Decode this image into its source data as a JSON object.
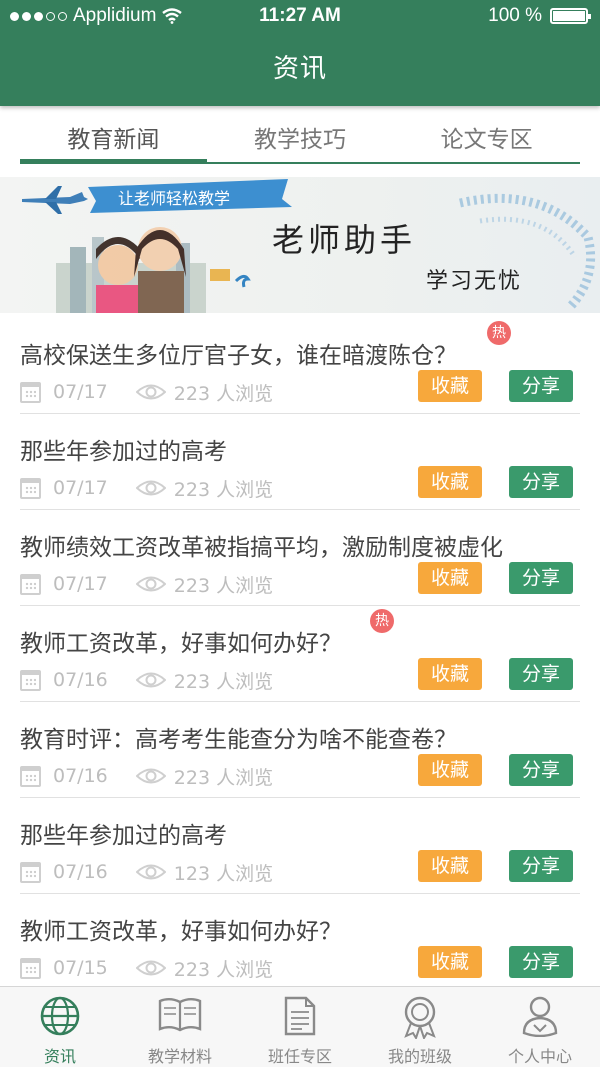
{
  "status": {
    "carrier": "Applidium",
    "time": "11:27 AM",
    "battery": "100 %"
  },
  "nav": {
    "title": "资讯"
  },
  "tabs": [
    {
      "label": "教育新闻",
      "active": true
    },
    {
      "label": "教学技巧",
      "active": false
    },
    {
      "label": "论文专区",
      "active": false
    }
  ],
  "banner": {
    "ribbon": "让老师轻松教学",
    "headline": "老师助手",
    "tagline": "学习无忧"
  },
  "hot_label": "热",
  "buttons": {
    "favorite": "收藏",
    "share": "分享"
  },
  "items": [
    {
      "title": "高校保送生多位厅官子女，谁在暗渡陈仓？",
      "date": "07/17",
      "views": "223 人浏览",
      "hot": true
    },
    {
      "title": "那些年参加过的高考",
      "date": "07/17",
      "views": "223 人浏览",
      "hot": false
    },
    {
      "title": "教师绩效工资改革被指搞平均，激励制度被虚化",
      "date": "07/17",
      "views": "223 人浏览",
      "hot": false
    },
    {
      "title": "教师工资改革，好事如何办好？",
      "date": "07/16",
      "views": "223 人浏览",
      "hot": true
    },
    {
      "title": "教育时评：高考考生能查分为啥不能查卷？",
      "date": "07/16",
      "views": "223 人浏览",
      "hot": false
    },
    {
      "title": "那些年参加过的高考",
      "date": "07/16",
      "views": "123 人浏览",
      "hot": false
    },
    {
      "title": "教师工资改革，好事如何办好？",
      "date": "07/15",
      "views": "223 人浏览",
      "hot": false
    }
  ],
  "bottom_tabs": [
    {
      "label": "资讯",
      "icon": "globe-icon",
      "active": true
    },
    {
      "label": "教学材料",
      "icon": "book-icon",
      "active": false
    },
    {
      "label": "班任专区",
      "icon": "document-icon",
      "active": false
    },
    {
      "label": "我的班级",
      "icon": "award-icon",
      "active": false
    },
    {
      "label": "个人中心",
      "icon": "user-icon",
      "active": false
    }
  ],
  "colors": {
    "primary": "#357f5c",
    "favorite": "#f7a83c",
    "share": "#3a9a6c",
    "hot": "#ef6a6a"
  }
}
